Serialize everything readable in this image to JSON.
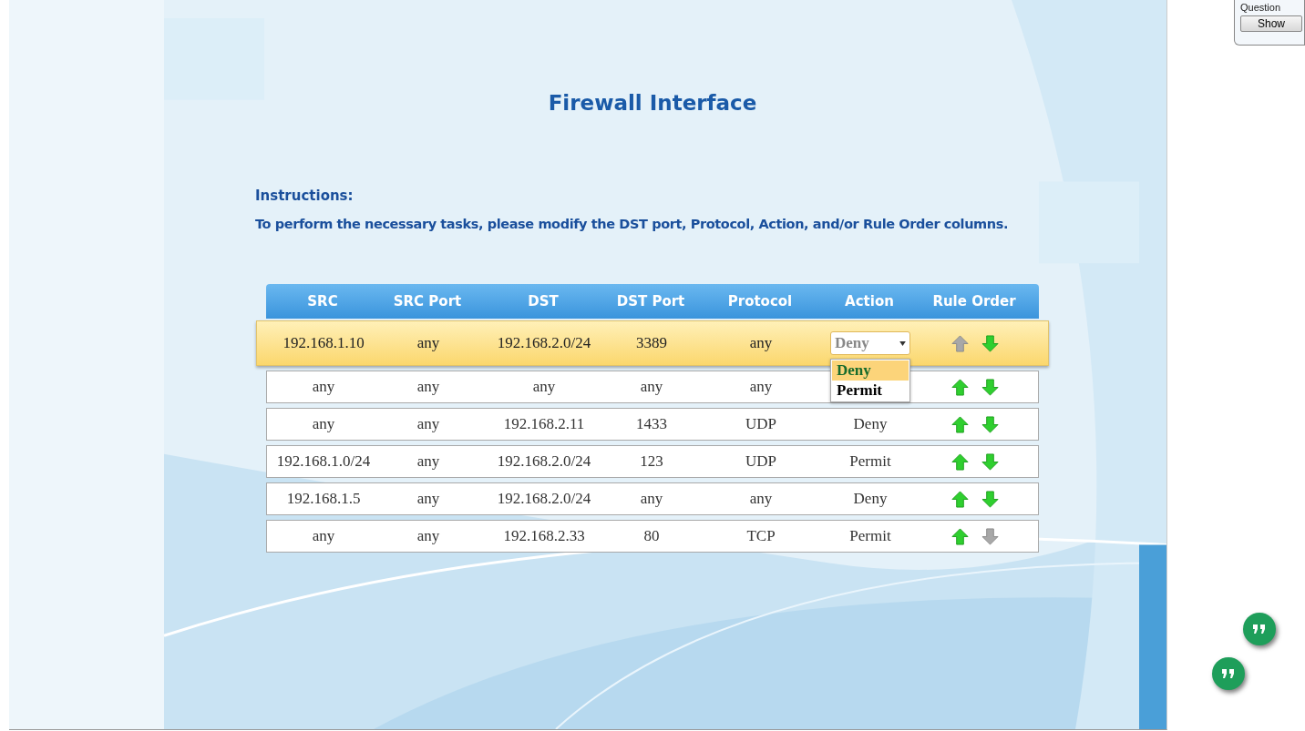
{
  "title": "Firewall Interface",
  "instructions": {
    "heading": "Instructions:",
    "text": "To perform the necessary  tasks, please modify the DST port, Protocol, Action, and/or Rule Order columns."
  },
  "table": {
    "columns": [
      "SRC",
      "SRC Port",
      "DST",
      "DST Port",
      "Protocol",
      "Action",
      "Rule Order"
    ],
    "rows": [
      {
        "src": "192.168.1.10",
        "src_port": "any",
        "dst": "192.168.2.0/24",
        "dst_port": "3389",
        "protocol": "any",
        "selected": true,
        "action_select": {
          "value": "Deny",
          "expanded": true,
          "options": [
            {
              "label": "Deny",
              "selected": true
            },
            {
              "label": "Permit",
              "selected": false
            }
          ]
        },
        "up_disabled": true,
        "down_disabled": false
      },
      {
        "src": "any",
        "src_port": "any",
        "dst": "any",
        "dst_port": "any",
        "protocol": "any",
        "selected": false,
        "up_disabled": false,
        "down_disabled": false
      },
      {
        "src": "any",
        "src_port": "any",
        "dst": "192.168.2.11",
        "dst_port": "1433",
        "protocol": "UDP",
        "action": "Deny",
        "selected": false,
        "up_disabled": false,
        "down_disabled": false
      },
      {
        "src": "192.168.1.0/24",
        "src_port": "any",
        "dst": "192.168.2.0/24",
        "dst_port": "123",
        "protocol": "UDP",
        "action": "Permit",
        "selected": false,
        "up_disabled": false,
        "down_disabled": false
      },
      {
        "src": "192.168.1.5",
        "src_port": "any",
        "dst": "192.168.2.0/24",
        "dst_port": "any",
        "protocol": "any",
        "action": "Deny",
        "selected": false,
        "up_disabled": false,
        "down_disabled": false
      },
      {
        "src": "any",
        "src_port": "any",
        "dst": "192.168.2.33",
        "dst_port": "80",
        "protocol": "TCP",
        "action": "Permit",
        "selected": false,
        "up_disabled": false,
        "down_disabled": true
      }
    ]
  },
  "question_panel": {
    "label": "Question",
    "button": "Show"
  }
}
